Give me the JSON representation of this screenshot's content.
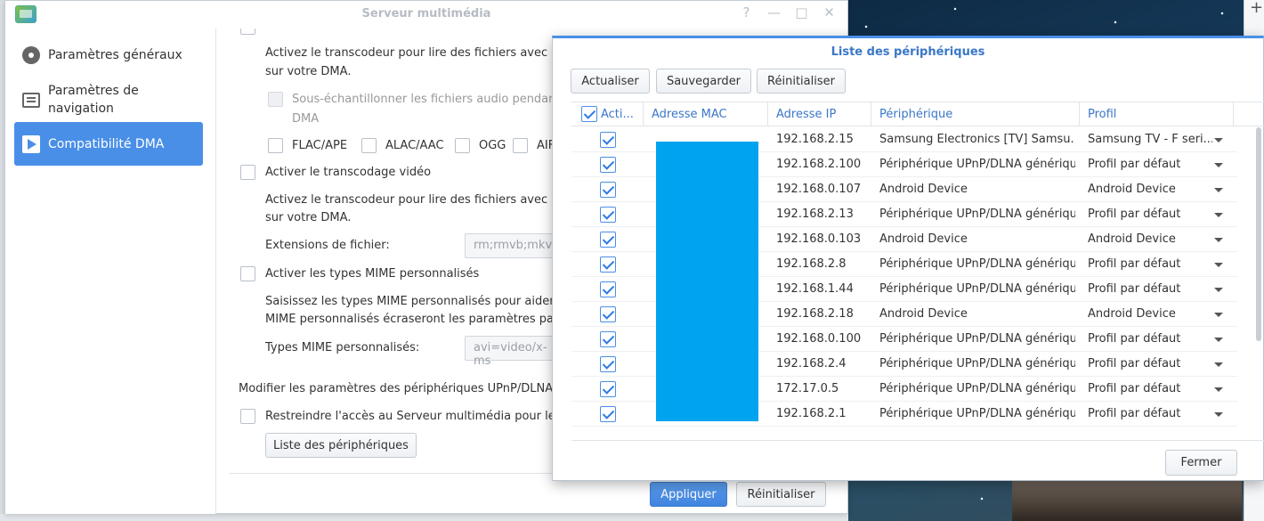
{
  "main_window": {
    "title": "Serveur multimédia",
    "controls": [
      "?",
      "—",
      "□",
      "✕"
    ]
  },
  "sidebar": {
    "items": [
      {
        "label": "Paramètres généraux",
        "icon": "gear-icon"
      },
      {
        "label": "Paramètres de navigation",
        "icon": "navigation-icon"
      },
      {
        "label": "Compatibilité DMA",
        "icon": "play-icon",
        "active": true
      }
    ]
  },
  "content": {
    "audio_transcode_desc_1": "Activez le transcodeur pour lire des fichiers avec les fo",
    "audio_transcode_desc_2": "sur votre DMA.",
    "downsample_label_1": "Sous-échantillonner les fichiers audio pendant le",
    "downsample_label_2": "DMA",
    "formats": [
      "FLAC/APE",
      "ALAC/AAC",
      "OGG",
      "AIF"
    ],
    "video_transcode_label": "Activer le transcodage vidéo",
    "video_transcode_desc_1": "Activez le transcodeur pour lire des fichiers avec les fo",
    "video_transcode_desc_2": "sur votre DMA.",
    "file_ext_label": "Extensions de fichier:",
    "file_ext_value": "rm;rmvb;mkv",
    "mime_label": "Activer les types MIME personnalisés",
    "mime_desc_1": "Saisissez les types MIME personnalisés pour aider DM",
    "mime_desc_2": "MIME personnalisés écraseront les paramètres par dé",
    "mime_types_label": "Types MIME personnalisés:",
    "mime_types_value": "avi=video/x-ms",
    "upnp_desc": "Modifier les paramètres des périphériques UPnP/DLNA au s",
    "restrict_label": "Restreindre l'accès au Serveur multimédia pour les ap",
    "device_list_button": "Liste des périphériques",
    "apply_button": "Appliquer",
    "reset_button": "Réinitialiser"
  },
  "dialog": {
    "title": "Liste des périphériques",
    "toolbar": {
      "refresh": "Actualiser",
      "save": "Sauvegarder",
      "reset": "Réinitialiser"
    },
    "columns": {
      "active": "Acti...",
      "mac": "Adresse MAC",
      "ip": "Adresse IP",
      "device": "Périphérique",
      "profile": "Profil"
    },
    "rows": [
      {
        "ip": "192.168.2.15",
        "device": "Samsung Electronics [TV] Samsu...",
        "profile": "Samsung TV - F seri..."
      },
      {
        "ip": "192.168.2.100",
        "device": "Périphérique UPnP/DLNA générique",
        "profile": "Profil par défaut"
      },
      {
        "ip": "192.168.0.107",
        "device": "Android Device",
        "profile": "Android Device"
      },
      {
        "ip": "192.168.2.13",
        "device": "Périphérique UPnP/DLNA générique",
        "profile": "Profil par défaut"
      },
      {
        "ip": "192.168.0.103",
        "device": "Android Device",
        "profile": "Android Device"
      },
      {
        "ip": "192.168.2.8",
        "device": "Périphérique UPnP/DLNA générique",
        "profile": "Profil par défaut"
      },
      {
        "ip": "192.168.1.44",
        "device": "Périphérique UPnP/DLNA générique",
        "profile": "Profil par défaut"
      },
      {
        "ip": "192.168.2.18",
        "device": "Android Device",
        "profile": "Android Device"
      },
      {
        "ip": "192.168.0.100",
        "device": "Périphérique UPnP/DLNA générique",
        "profile": "Profil par défaut"
      },
      {
        "ip": "192.168.2.4",
        "device": "Périphérique UPnP/DLNA générique",
        "profile": "Profil par défaut"
      },
      {
        "ip": "172.17.0.5",
        "device": "Périphérique UPnP/DLNA générique",
        "profile": "Profil par défaut"
      },
      {
        "ip": "192.168.2.1",
        "device": "Périphérique UPnP/DLNA générique",
        "profile": "Profil par défaut"
      }
    ],
    "close_button": "Fermer"
  },
  "colors": {
    "accent": "#4a8fe7",
    "redaction": "#00a3ef"
  }
}
